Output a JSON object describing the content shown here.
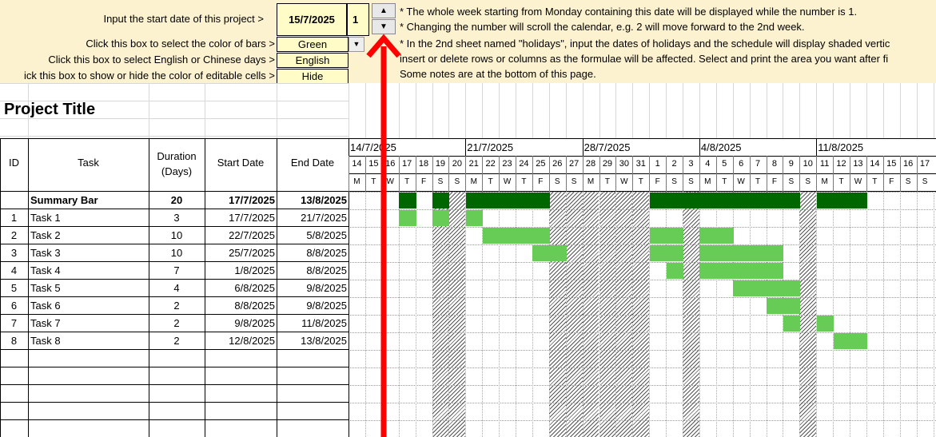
{
  "settings": {
    "start_label": "Input the start date of this project >",
    "start_value": "15/7/2025",
    "week_number": "1",
    "color_label": "Click this box to select the color of bars >",
    "color_value": "Green",
    "lang_label": "Click this box to select English or Chinese days >",
    "lang_value": "English",
    "editable_label": "ick this box to show or hide the color of editable cells >",
    "editable_value": "Hide"
  },
  "notes": [
    "* The whole week starting from Monday containing this date will be displayed while the number is 1.",
    "* Changing the number will scroll the calendar, e.g. 2 will move forward to the 2nd week.",
    "* In the 2nd sheet named \"holidays\", input the dates of holidays and the schedule will display shaded vertic",
    "insert or delete rows or columns as the formulae will be affected. Select and print the area you want after fi",
    "Some notes are at the bottom of this page."
  ],
  "title": "Project Title",
  "headers": {
    "id": "ID",
    "task": "Task",
    "duration_1": "Duration",
    "duration_2": "(Days)",
    "start": "Start Date",
    "end": "End Date"
  },
  "weeks": [
    "14/7/2025",
    "21/7/2025",
    "28/7/2025",
    "4/8/2025",
    "11/8/2025"
  ],
  "days": [
    "14",
    "15",
    "16",
    "17",
    "18",
    "19",
    "20",
    "21",
    "22",
    "23",
    "24",
    "25",
    "26",
    "27",
    "28",
    "29",
    "30",
    "31",
    "1",
    "2",
    "3",
    "4",
    "5",
    "6",
    "7",
    "8",
    "9",
    "10",
    "11",
    "12",
    "13",
    "14",
    "15",
    "16",
    "17"
  ],
  "weekdays": [
    "M",
    "T",
    "W",
    "T",
    "F",
    "S",
    "S"
  ],
  "holiday_day_indices": [
    5,
    6,
    12,
    13,
    14,
    15,
    16,
    17,
    20,
    27
  ],
  "summary": {
    "task": "Summary Bar",
    "duration": "20",
    "start": "17/7/2025",
    "end": "13/8/2025",
    "bar_day_indices": [
      3,
      5,
      7,
      8,
      9,
      10,
      11,
      18,
      19,
      20,
      21,
      22,
      23,
      24,
      25,
      26,
      28,
      29,
      30
    ]
  },
  "tasks": [
    {
      "id": "1",
      "task": "Task 1",
      "duration": "3",
      "start": "17/7/2025",
      "end": "21/7/2025",
      "bar_day_indices": [
        3,
        5,
        7
      ]
    },
    {
      "id": "2",
      "task": "Task 2",
      "duration": "10",
      "start": "22/7/2025",
      "end": "5/8/2025",
      "bar_day_indices": [
        8,
        9,
        10,
        11,
        18,
        19,
        21,
        22
      ]
    },
    {
      "id": "3",
      "task": "Task 3",
      "duration": "10",
      "start": "25/7/2025",
      "end": "8/8/2025",
      "bar_day_indices": [
        11,
        12,
        18,
        19,
        21,
        22,
        23,
        24,
        25
      ]
    },
    {
      "id": "4",
      "task": "Task 4",
      "duration": "7",
      "start": "1/8/2025",
      "end": "8/8/2025",
      "bar_day_indices": [
        19,
        21,
        22,
        23,
        24,
        25
      ]
    },
    {
      "id": "5",
      "task": "Task 5",
      "duration": "4",
      "start": "6/8/2025",
      "end": "9/8/2025",
      "bar_day_indices": [
        23,
        24,
        25,
        26
      ]
    },
    {
      "id": "6",
      "task": "Task 6",
      "duration": "2",
      "start": "8/8/2025",
      "end": "9/8/2025",
      "bar_day_indices": [
        25,
        26
      ]
    },
    {
      "id": "7",
      "task": "Task 7",
      "duration": "2",
      "start": "9/8/2025",
      "end": "11/8/2025",
      "bar_day_indices": [
        26,
        28
      ]
    },
    {
      "id": "8",
      "task": "Task 8",
      "duration": "2",
      "start": "12/8/2025",
      "end": "13/8/2025",
      "bar_day_indices": [
        29,
        30
      ]
    }
  ],
  "empty_rows": 5,
  "colors": {
    "summary_bar": "#006600",
    "task_bar": "#66cc55",
    "top_band": "#fdf2d0",
    "input_box": "#fffcc8",
    "arrow": "#ff0000"
  }
}
